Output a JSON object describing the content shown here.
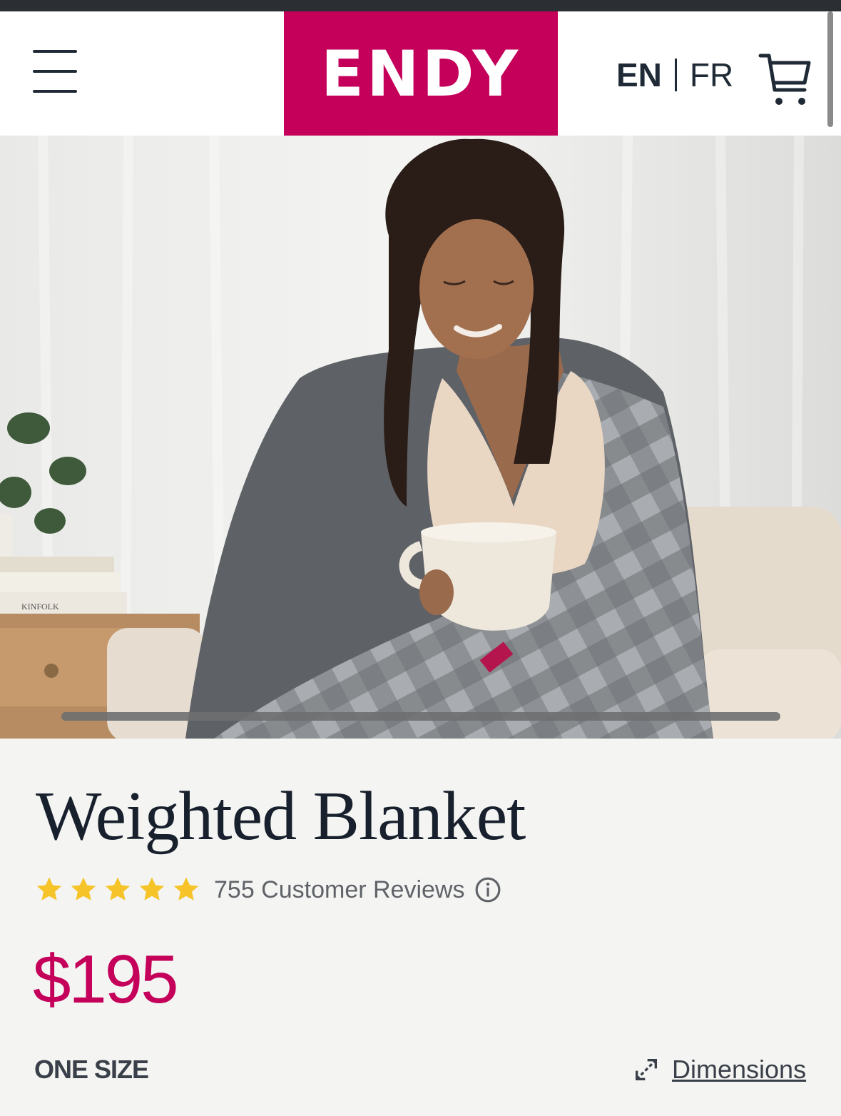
{
  "header": {
    "logo_text": "ENDY",
    "brand_color": "#c4005a",
    "lang_en": "EN",
    "lang_fr": "FR",
    "menu_icon": "hamburger-menu-icon",
    "cart_icon": "shopping-cart-icon"
  },
  "hero": {
    "image_subject": "woman wrapped in grey plaid weighted blanket holding a mug",
    "book_spine_text": "KINFOLK"
  },
  "product": {
    "title": "Weighted Blanket",
    "rating_stars": 5,
    "review_count_text": "755 Customer Reviews",
    "price": "$195",
    "price_color": "#c4005a",
    "size_label": "ONE SIZE",
    "dimensions_link": "Dimensions"
  }
}
